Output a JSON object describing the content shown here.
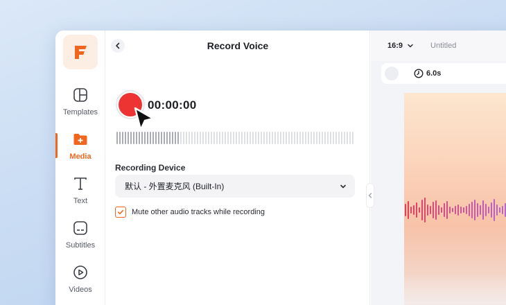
{
  "sidebar": {
    "items": [
      {
        "label": "Templates",
        "icon": "templates-icon",
        "active": false
      },
      {
        "label": "Media",
        "icon": "media-folder-icon",
        "active": true
      },
      {
        "label": "Text",
        "icon": "text-icon",
        "active": false
      },
      {
        "label": "Subtitles",
        "icon": "subtitles-icon",
        "active": false
      },
      {
        "label": "Videos",
        "icon": "videos-icon",
        "active": false
      }
    ]
  },
  "panel": {
    "title": "Record Voice",
    "timer": "00:00:00",
    "recording_device_label": "Recording Device",
    "device_value": "默认 - 外置麦克风 (Built-In)",
    "mute_label": "Mute other audio tracks while recording",
    "mute_checked": true
  },
  "editor": {
    "aspect_ratio": "16:9",
    "project_name": "Untitled",
    "duration": "6.0s"
  },
  "colors": {
    "accent": "#f0661e",
    "record": "#ee3333",
    "waveform_start": "#e2405a",
    "waveform_end": "#b46ad6"
  }
}
